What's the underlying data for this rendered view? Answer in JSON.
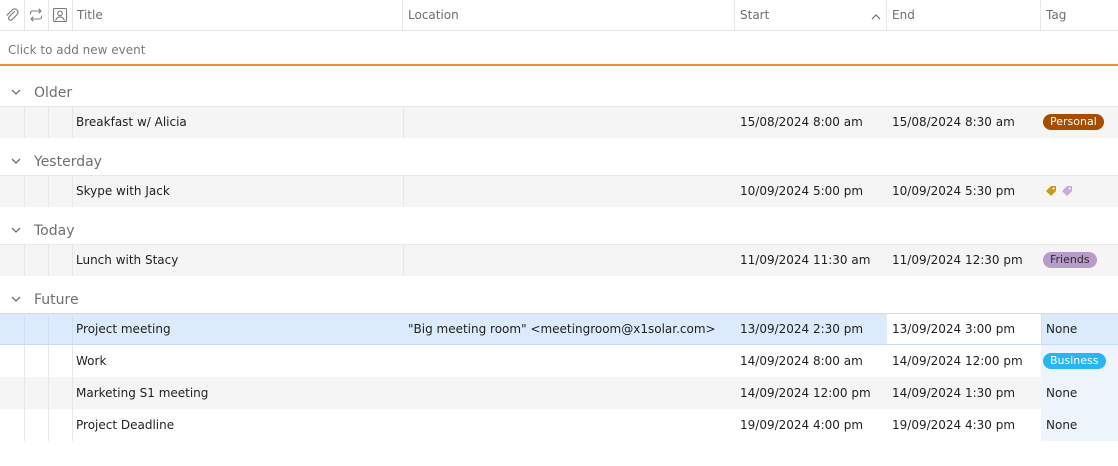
{
  "header": {
    "title": "Title",
    "location": "Location",
    "start": "Start",
    "end": "End",
    "tag": "Tag",
    "icons": [
      "paperclip-icon",
      "recurrence-icon",
      "contact-icon"
    ],
    "sort_icon": "chevron-up-icon"
  },
  "add_row": {
    "label": "Click to add new event"
  },
  "groups": [
    {
      "title": "Older"
    },
    {
      "title": "Yesterday"
    },
    {
      "title": "Today"
    },
    {
      "title": "Future"
    }
  ],
  "events": [
    {
      "title": "Breakfast w/ Alicia",
      "location": "",
      "start": "15/08/2024 8:00 am",
      "end": "15/08/2024 8:30 am",
      "tag": "Personal"
    },
    {
      "title": "Skype with Jack",
      "location": "",
      "start": "10/09/2024 5:00 pm",
      "end": "10/09/2024 5:30 pm",
      "tag": ""
    },
    {
      "title": "Lunch with Stacy",
      "location": "",
      "start": "11/09/2024 11:30 am",
      "end": "11/09/2024 12:30 pm",
      "tag": "Friends"
    },
    {
      "title": "Project meeting",
      "location": "\"Big meeting room\" <meetingroom@x1solar.com>",
      "start": "13/09/2024 2:30 pm",
      "end": "13/09/2024 3:00 pm",
      "tag": "None"
    },
    {
      "title": "Work",
      "location": "",
      "start": "14/09/2024 8:00 am",
      "end": "14/09/2024 12:00 pm",
      "tag": "Business"
    },
    {
      "title": "Marketing S1 meeting",
      "location": "",
      "start": "14/09/2024 12:00 pm",
      "end": "14/09/2024 1:30 pm",
      "tag": "None"
    },
    {
      "title": "Project Deadline",
      "location": "",
      "start": "19/09/2024 4:00 pm",
      "end": "19/09/2024 4:30 pm",
      "tag": "None"
    }
  ],
  "colors": {
    "accent_orange": "#f0922b",
    "personal_tag": "#a84d00",
    "friends_tag": "#b79bc9",
    "business_tag": "#29b6f0",
    "selection": "#dcebfb",
    "tag_icon_gold": "#c99a1a",
    "tag_icon_lilac": "#c9a8dd"
  }
}
